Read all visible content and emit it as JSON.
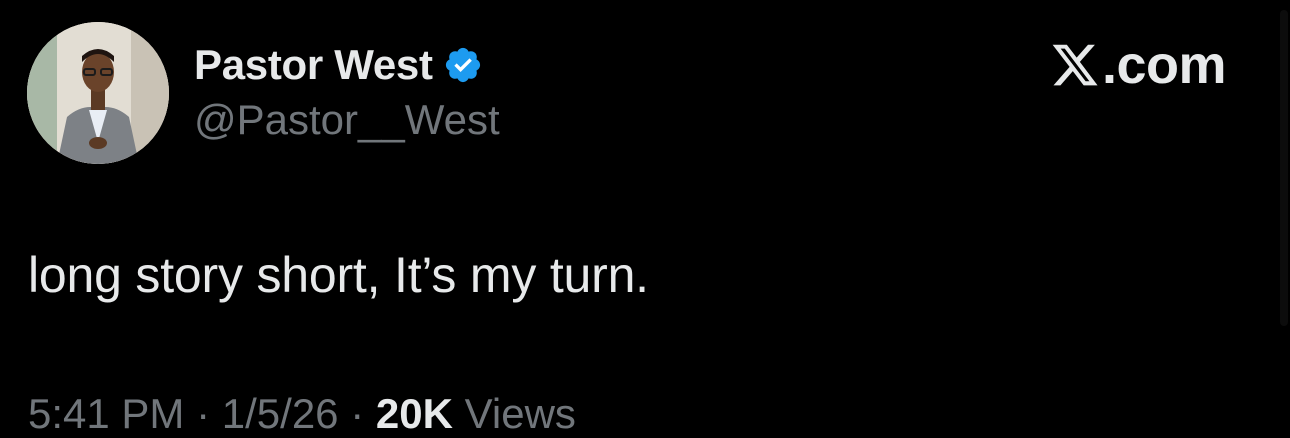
{
  "author": {
    "display_name": "Pastor West",
    "handle": "@Pastor__West",
    "verified": true,
    "verified_icon": "verified-badge-icon",
    "verified_color": "#1d9bf0"
  },
  "brand": {
    "icon": "x-logo-icon",
    "domain": ".com"
  },
  "tweet": {
    "text": "long story short, It’s my turn."
  },
  "meta": {
    "time": "5:41 PM",
    "separator": "·",
    "date": "1/5/26",
    "views_count": "20K",
    "views_label": "Views"
  },
  "colors": {
    "background": "#000000",
    "primary_text": "#e7e9ea",
    "secondary_text": "#71767b"
  }
}
